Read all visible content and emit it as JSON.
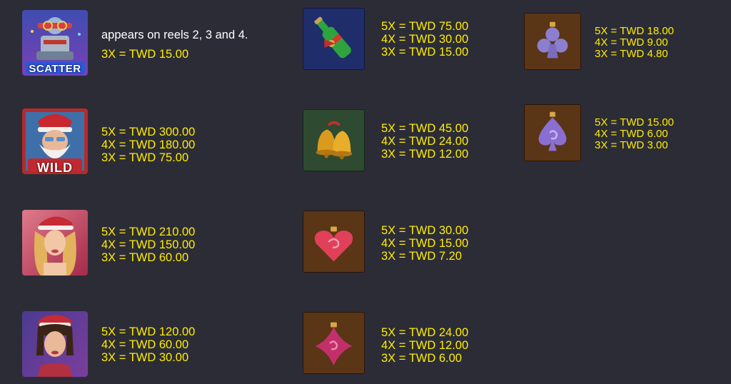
{
  "symbols": [
    {
      "icon": "scatter-symbol-icon",
      "badge": "SCATTER",
      "lines": [
        "appears on reels 2, 3 and 4.",
        "3X = TWD 15.00"
      ]
    },
    {
      "icon": "santa-wild-symbol-icon",
      "badge": "WILD",
      "lines": [
        "5X = TWD 300.00",
        "4X = TWD 180.00",
        "3X = TWD 75.00"
      ]
    },
    {
      "icon": "blonde-girl-symbol-icon",
      "lines": [
        "5X = TWD 210.00",
        "4X = TWD 150.00",
        "3X = TWD 60.00"
      ]
    },
    {
      "icon": "brunette-girl-symbol-icon",
      "lines": [
        "5X = TWD 120.00",
        "4X = TWD 60.00",
        "3X = TWD 30.00"
      ]
    },
    {
      "icon": "bottle-symbol-icon",
      "lines": [
        "5X = TWD 75.00",
        "4X = TWD 30.00",
        "3X = TWD 15.00"
      ]
    },
    {
      "icon": "bells-symbol-icon",
      "lines": [
        "5X = TWD 45.00",
        "4X = TWD 24.00",
        "3X = TWD 12.00"
      ]
    },
    {
      "icon": "heart-ornament-symbol-icon",
      "lines": [
        "5X = TWD 30.00",
        "4X = TWD 15.00",
        "3X = TWD 7.20"
      ]
    },
    {
      "icon": "diamond-ornament-symbol-icon",
      "lines": [
        "5X = TWD 24.00",
        "4X = TWD 12.00",
        "3X = TWD 6.00"
      ]
    },
    {
      "icon": "club-ornament-symbol-icon",
      "lines": [
        "5X = TWD 18.00",
        "4X = TWD 9.00",
        "3X = TWD 4.80"
      ]
    },
    {
      "icon": "spade-ornament-symbol-icon",
      "lines": [
        "5X = TWD 15.00",
        "4X = TWD 6.00",
        "3X = TWD 3.00"
      ]
    }
  ],
  "colors": {
    "background": "#2c2c37",
    "payout": "#ffee00",
    "note": "#ffffff"
  }
}
